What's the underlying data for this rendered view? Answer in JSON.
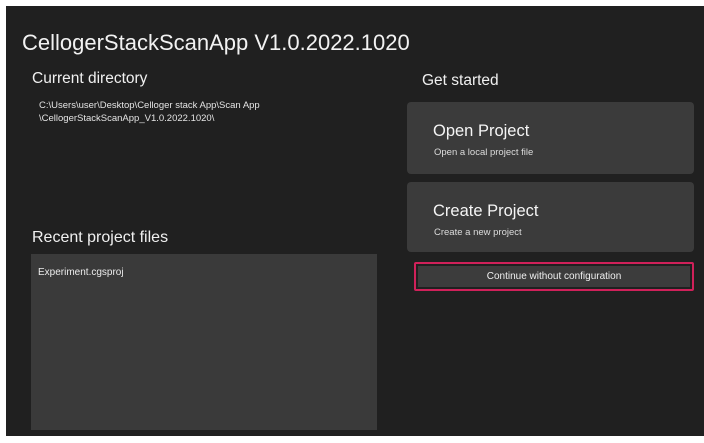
{
  "app": {
    "title": "CellogerStackScanApp V1.0.2022.1020"
  },
  "current_directory": {
    "heading": "Current directory",
    "path_line1": "C:\\Users\\user\\Desktop\\Celloger stack App\\Scan App",
    "path_line2": "\\CellogerStackScanApp_V1.0.2022.1020\\"
  },
  "recent_projects": {
    "heading": "Recent project files",
    "items": [
      {
        "name": "Experiment.cgsproj"
      }
    ]
  },
  "get_started": {
    "heading": "Get started",
    "open_project": {
      "title": "Open Project",
      "subtitle": "Open a local project file"
    },
    "create_project": {
      "title": "Create Project",
      "subtitle": "Create a new project"
    },
    "continue_button": {
      "label": "Continue without configuration"
    }
  },
  "colors": {
    "background": "#202020",
    "card": "#3b3b3b",
    "highlight": "#d0215a"
  }
}
